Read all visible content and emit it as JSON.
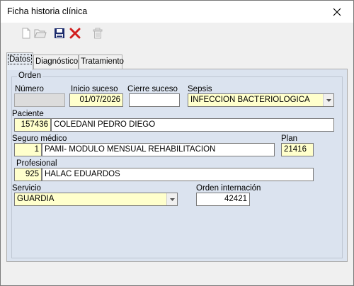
{
  "window": {
    "title": "Ficha historia clínica"
  },
  "toolbar": {
    "icons": [
      "new-document-icon",
      "open-folder-icon",
      "save-disk-icon",
      "delete-x-icon",
      "trash-can-icon"
    ]
  },
  "tabs": [
    {
      "label": "Datos",
      "active": true
    },
    {
      "label": "Diagnóstico",
      "active": false
    },
    {
      "label": "Tratamiento",
      "active": false
    }
  ],
  "orden": {
    "group_title": "Orden",
    "numero_label": "Número",
    "numero_value": "",
    "inicio_label": "Inicio suceso",
    "inicio_value": "01/07/2026",
    "cierre_label": "Cierre suceso",
    "cierre_value": "",
    "sepsis_label": "Sepsis",
    "sepsis_value": "INFECCION BACTERIOLOGICA"
  },
  "paciente": {
    "label": "Paciente",
    "id": "157436",
    "name": "COLEDANI PEDRO DIEGO"
  },
  "seguro": {
    "label": "Seguro médico",
    "id": "1",
    "name": "PAMI- MODULO MENSUAL REHABILITACION",
    "plan_label": "Plan",
    "plan_value": "21416"
  },
  "profesional": {
    "label": "Profesional",
    "id": "925",
    "name": "HALAC EDUARDOS"
  },
  "servicio": {
    "label": "Servicio",
    "value": "GUARDIA"
  },
  "internacion": {
    "label": "Orden internación",
    "value": "42421"
  },
  "colors": {
    "panel": "#dbe3ef",
    "required_field": "#ffffcc",
    "delete_red": "#d11f1f",
    "save_navy": "#1a2a6c"
  }
}
